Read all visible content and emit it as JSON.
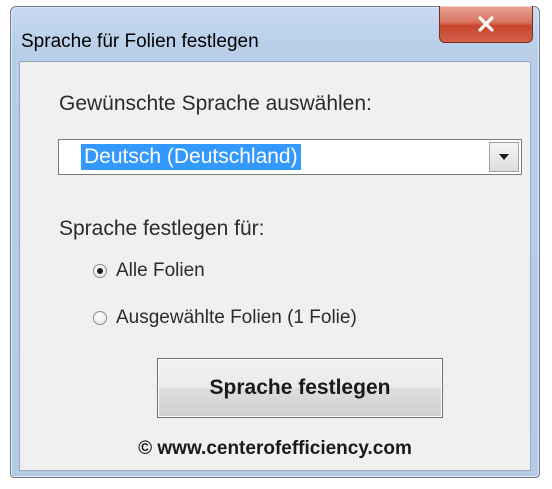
{
  "window": {
    "title": "Sprache für Folien festlegen",
    "close_icon": "close-x-icon",
    "close_color": "#c8452b"
  },
  "language_select": {
    "label": "Gewünschte Sprache auswählen:",
    "selected_value": "Deutsch (Deutschland)",
    "arrow_icon": "chevron-down-icon"
  },
  "apply_to": {
    "label": "Sprache festlegen für:",
    "options": [
      {
        "label": "Alle Folien",
        "checked": true
      },
      {
        "label": "Ausgewählte Folien (1 Folie)",
        "checked": false
      }
    ]
  },
  "action_button": {
    "label": "Sprache festlegen"
  },
  "footer": {
    "copyright": "© www.centerofefficiency.com"
  }
}
